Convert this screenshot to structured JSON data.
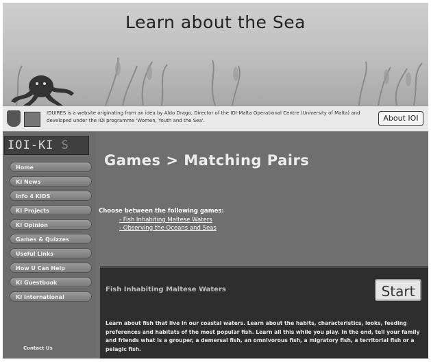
{
  "banner": {
    "title": "Learn about the Sea"
  },
  "info_strip": {
    "text": "IDUIRES is a website originating from an idea by Aldo Drago, Director of the IOI-Malta Operational Centre (University of Malta) and developed under the IOI programme 'Women, Youth and the Sea'.",
    "about_button": "About IOI"
  },
  "sidebar": {
    "logo_text": "IOI-KI",
    "logo_ghost": "S",
    "nav": [
      {
        "label": "Home"
      },
      {
        "label": "KI News"
      },
      {
        "label": "Info 4 KIDS"
      },
      {
        "label": "KI Projects"
      },
      {
        "label": "KI Opinion"
      },
      {
        "label": "Games & Quizzes"
      },
      {
        "label": "Useful Links"
      },
      {
        "label": "How U Can Help"
      },
      {
        "label": "KI Guestbook"
      },
      {
        "label": "KI International"
      }
    ],
    "contact": "Contact Us"
  },
  "main": {
    "title": "Games > Matching Pairs",
    "intro": "Choose between the following games:",
    "links": [
      "- Fish Inhabiting Maltese Waters",
      "- Observing the Oceans and Seas"
    ]
  },
  "game_panel": {
    "title": "Fish Inhabiting Maltese Waters",
    "start_label": "Start",
    "description": "Learn about fish that live in our coastal waters. Learn about the habits, characteristics, looks, feeding preferences and habitats of the most popular fish. Learn all this while you play. In the end, tell your family and friends what is a grouper, a demersal fish, an omnivorous fish, a migratory fish, a territorial fish or a pelagic fish."
  }
}
